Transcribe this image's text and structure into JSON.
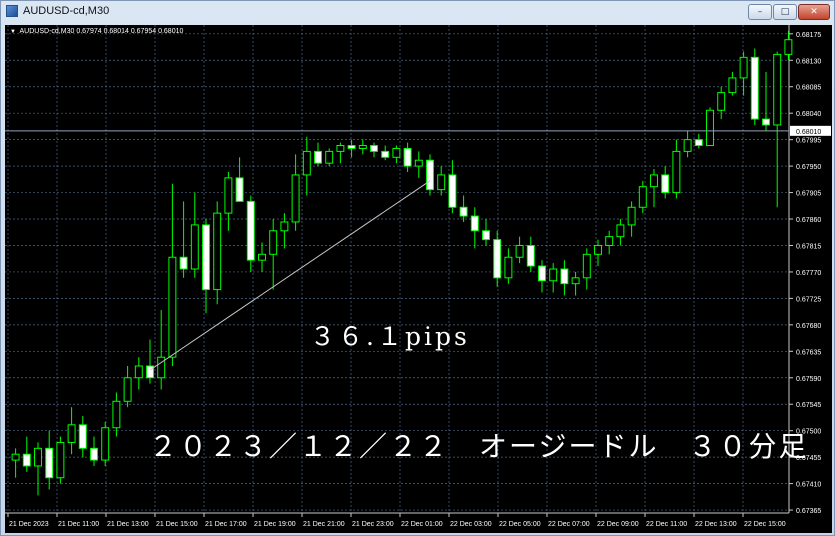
{
  "window": {
    "title": "AUDUSD-cd,M30",
    "buttons": {
      "minimize": "–",
      "maximize": "□",
      "close": "✕"
    }
  },
  "chart_header": {
    "symbol": "AUDUSD-cd,M30",
    "ohlc": "0.67974 0.68014 0.67954 0.68010"
  },
  "annotations": {
    "pips": "３６.１pips",
    "caption": "２０２３／１２／２２　オージードル　３０分足"
  },
  "colors": {
    "background": "#000000",
    "grid": "#4d6a8a",
    "candle": "#00ff00",
    "bull_body": "#000000",
    "bear_body": "#ffffff",
    "text": "#ffffff",
    "current_price_line": "#8fa3b8",
    "trendline": "#c8c8c8"
  },
  "chart_data": {
    "type": "candlestick",
    "symbol": "AUDUSD-cd",
    "timeframe": "M30",
    "ylim": [
      0.6736,
      0.6819
    ],
    "y_ticks": [
      "0.68175",
      "0.68130",
      "0.68085",
      "0.68040",
      "0.67995",
      "0.67950",
      "0.67905",
      "0.67860",
      "0.67815",
      "0.67770",
      "0.67725",
      "0.67680",
      "0.67635",
      "0.67590",
      "0.67545",
      "0.67500",
      "0.67455",
      "0.67410",
      "0.67365"
    ],
    "x_ticks": [
      "21 Dec 2023",
      "21 Dec 11:00",
      "21 Dec 13:00",
      "21 Dec 15:00",
      "21 Dec 17:00",
      "21 Dec 19:00",
      "21 Dec 21:00",
      "21 Dec 23:00",
      "22 Dec 01:00",
      "22 Dec 03:00",
      "22 Dec 05:00",
      "22 Dec 07:00",
      "22 Dec 09:00",
      "22 Dec 11:00",
      "22 Dec 13:00",
      "22 Dec 15:00"
    ],
    "current_price": "0.68010",
    "current_price_value": 0.6801,
    "trendline": {
      "from": [
        12,
        0.67603
      ],
      "to": [
        37,
        0.67925
      ]
    },
    "candles": [
      {
        "o": 0.6745,
        "h": 0.6747,
        "l": 0.6742,
        "c": 0.6746
      },
      {
        "o": 0.6746,
        "h": 0.6749,
        "l": 0.6743,
        "c": 0.6744
      },
      {
        "o": 0.6744,
        "h": 0.6748,
        "l": 0.6739,
        "c": 0.6747
      },
      {
        "o": 0.6747,
        "h": 0.675,
        "l": 0.674,
        "c": 0.6742
      },
      {
        "o": 0.6742,
        "h": 0.6749,
        "l": 0.6741,
        "c": 0.6748
      },
      {
        "o": 0.6748,
        "h": 0.6754,
        "l": 0.6746,
        "c": 0.6751
      },
      {
        "o": 0.6751,
        "h": 0.67525,
        "l": 0.67455,
        "c": 0.6747
      },
      {
        "o": 0.6747,
        "h": 0.6749,
        "l": 0.6744,
        "c": 0.6745
      },
      {
        "o": 0.6745,
        "h": 0.67515,
        "l": 0.6744,
        "c": 0.67505
      },
      {
        "o": 0.67505,
        "h": 0.67565,
        "l": 0.6749,
        "c": 0.6755
      },
      {
        "o": 0.6755,
        "h": 0.6761,
        "l": 0.6754,
        "c": 0.6759
      },
      {
        "o": 0.6759,
        "h": 0.67625,
        "l": 0.6757,
        "c": 0.6761
      },
      {
        "o": 0.6761,
        "h": 0.67655,
        "l": 0.6758,
        "c": 0.6759
      },
      {
        "o": 0.6759,
        "h": 0.67705,
        "l": 0.6757,
        "c": 0.67625
      },
      {
        "o": 0.67625,
        "h": 0.6792,
        "l": 0.6761,
        "c": 0.67795
      },
      {
        "o": 0.67795,
        "h": 0.6789,
        "l": 0.6776,
        "c": 0.67775
      },
      {
        "o": 0.67775,
        "h": 0.67905,
        "l": 0.6776,
        "c": 0.6785
      },
      {
        "o": 0.6785,
        "h": 0.6786,
        "l": 0.677,
        "c": 0.6774
      },
      {
        "o": 0.6774,
        "h": 0.6789,
        "l": 0.67715,
        "c": 0.6787
      },
      {
        "o": 0.6787,
        "h": 0.6794,
        "l": 0.6784,
        "c": 0.6793
      },
      {
        "o": 0.6793,
        "h": 0.67965,
        "l": 0.6791,
        "c": 0.6789
      },
      {
        "o": 0.6789,
        "h": 0.679,
        "l": 0.6777,
        "c": 0.6779
      },
      {
        "o": 0.6779,
        "h": 0.6782,
        "l": 0.6777,
        "c": 0.678
      },
      {
        "o": 0.678,
        "h": 0.6786,
        "l": 0.6774,
        "c": 0.6784
      },
      {
        "o": 0.6784,
        "h": 0.6787,
        "l": 0.6781,
        "c": 0.67855
      },
      {
        "o": 0.67855,
        "h": 0.6797,
        "l": 0.6784,
        "c": 0.67935
      },
      {
        "o": 0.67935,
        "h": 0.68,
        "l": 0.679,
        "c": 0.67975
      },
      {
        "o": 0.67975,
        "h": 0.6799,
        "l": 0.6795,
        "c": 0.67955
      },
      {
        "o": 0.67955,
        "h": 0.6798,
        "l": 0.6795,
        "c": 0.67975
      },
      {
        "o": 0.67975,
        "h": 0.6799,
        "l": 0.67955,
        "c": 0.67985
      },
      {
        "o": 0.67985,
        "h": 0.67995,
        "l": 0.67965,
        "c": 0.6798
      },
      {
        "o": 0.6798,
        "h": 0.67995,
        "l": 0.6797,
        "c": 0.67985
      },
      {
        "o": 0.67985,
        "h": 0.6799,
        "l": 0.67965,
        "c": 0.67975
      },
      {
        "o": 0.67975,
        "h": 0.67985,
        "l": 0.6796,
        "c": 0.67965
      },
      {
        "o": 0.67965,
        "h": 0.67985,
        "l": 0.67955,
        "c": 0.6798
      },
      {
        "o": 0.6798,
        "h": 0.6799,
        "l": 0.6794,
        "c": 0.6795
      },
      {
        "o": 0.6795,
        "h": 0.67975,
        "l": 0.6793,
        "c": 0.6796
      },
      {
        "o": 0.6796,
        "h": 0.6797,
        "l": 0.679,
        "c": 0.6791
      },
      {
        "o": 0.6791,
        "h": 0.6795,
        "l": 0.679,
        "c": 0.67935
      },
      {
        "o": 0.67935,
        "h": 0.6796,
        "l": 0.6787,
        "c": 0.6788
      },
      {
        "o": 0.6788,
        "h": 0.679,
        "l": 0.67855,
        "c": 0.67865
      },
      {
        "o": 0.67865,
        "h": 0.6788,
        "l": 0.6781,
        "c": 0.6784
      },
      {
        "o": 0.6784,
        "h": 0.6786,
        "l": 0.67815,
        "c": 0.67825
      },
      {
        "o": 0.67825,
        "h": 0.6784,
        "l": 0.67745,
        "c": 0.6776
      },
      {
        "o": 0.6776,
        "h": 0.6781,
        "l": 0.6775,
        "c": 0.67795
      },
      {
        "o": 0.67795,
        "h": 0.6783,
        "l": 0.67785,
        "c": 0.67815
      },
      {
        "o": 0.67815,
        "h": 0.6783,
        "l": 0.6777,
        "c": 0.6778
      },
      {
        "o": 0.6778,
        "h": 0.6779,
        "l": 0.67735,
        "c": 0.67755
      },
      {
        "o": 0.67755,
        "h": 0.67785,
        "l": 0.67735,
        "c": 0.67775
      },
      {
        "o": 0.67775,
        "h": 0.6779,
        "l": 0.6773,
        "c": 0.6775
      },
      {
        "o": 0.6775,
        "h": 0.6777,
        "l": 0.6773,
        "c": 0.6776
      },
      {
        "o": 0.6776,
        "h": 0.6781,
        "l": 0.6774,
        "c": 0.678
      },
      {
        "o": 0.678,
        "h": 0.67825,
        "l": 0.6778,
        "c": 0.67815
      },
      {
        "o": 0.67815,
        "h": 0.6784,
        "l": 0.678,
        "c": 0.6783
      },
      {
        "o": 0.6783,
        "h": 0.6786,
        "l": 0.67815,
        "c": 0.6785
      },
      {
        "o": 0.6785,
        "h": 0.6789,
        "l": 0.6783,
        "c": 0.6788
      },
      {
        "o": 0.6788,
        "h": 0.67925,
        "l": 0.6787,
        "c": 0.67915
      },
      {
        "o": 0.67915,
        "h": 0.67945,
        "l": 0.6788,
        "c": 0.67935
      },
      {
        "o": 0.67935,
        "h": 0.6795,
        "l": 0.67895,
        "c": 0.67905
      },
      {
        "o": 0.67905,
        "h": 0.67995,
        "l": 0.67895,
        "c": 0.67975
      },
      {
        "o": 0.67975,
        "h": 0.6801,
        "l": 0.67965,
        "c": 0.67995
      },
      {
        "o": 0.67995,
        "h": 0.68005,
        "l": 0.6798,
        "c": 0.67985
      },
      {
        "o": 0.67985,
        "h": 0.6805,
        "l": 0.67985,
        "c": 0.68045
      },
      {
        "o": 0.68045,
        "h": 0.68085,
        "l": 0.6803,
        "c": 0.68075
      },
      {
        "o": 0.68075,
        "h": 0.6811,
        "l": 0.6807,
        "c": 0.681
      },
      {
        "o": 0.681,
        "h": 0.68145,
        "l": 0.6807,
        "c": 0.68135
      },
      {
        "o": 0.68135,
        "h": 0.6815,
        "l": 0.6802,
        "c": 0.6803
      },
      {
        "o": 0.6803,
        "h": 0.6811,
        "l": 0.6801,
        "c": 0.6802
      },
      {
        "o": 0.6802,
        "h": 0.68145,
        "l": 0.6788,
        "c": 0.6814
      },
      {
        "o": 0.6814,
        "h": 0.6818,
        "l": 0.6813,
        "c": 0.68165
      }
    ]
  }
}
